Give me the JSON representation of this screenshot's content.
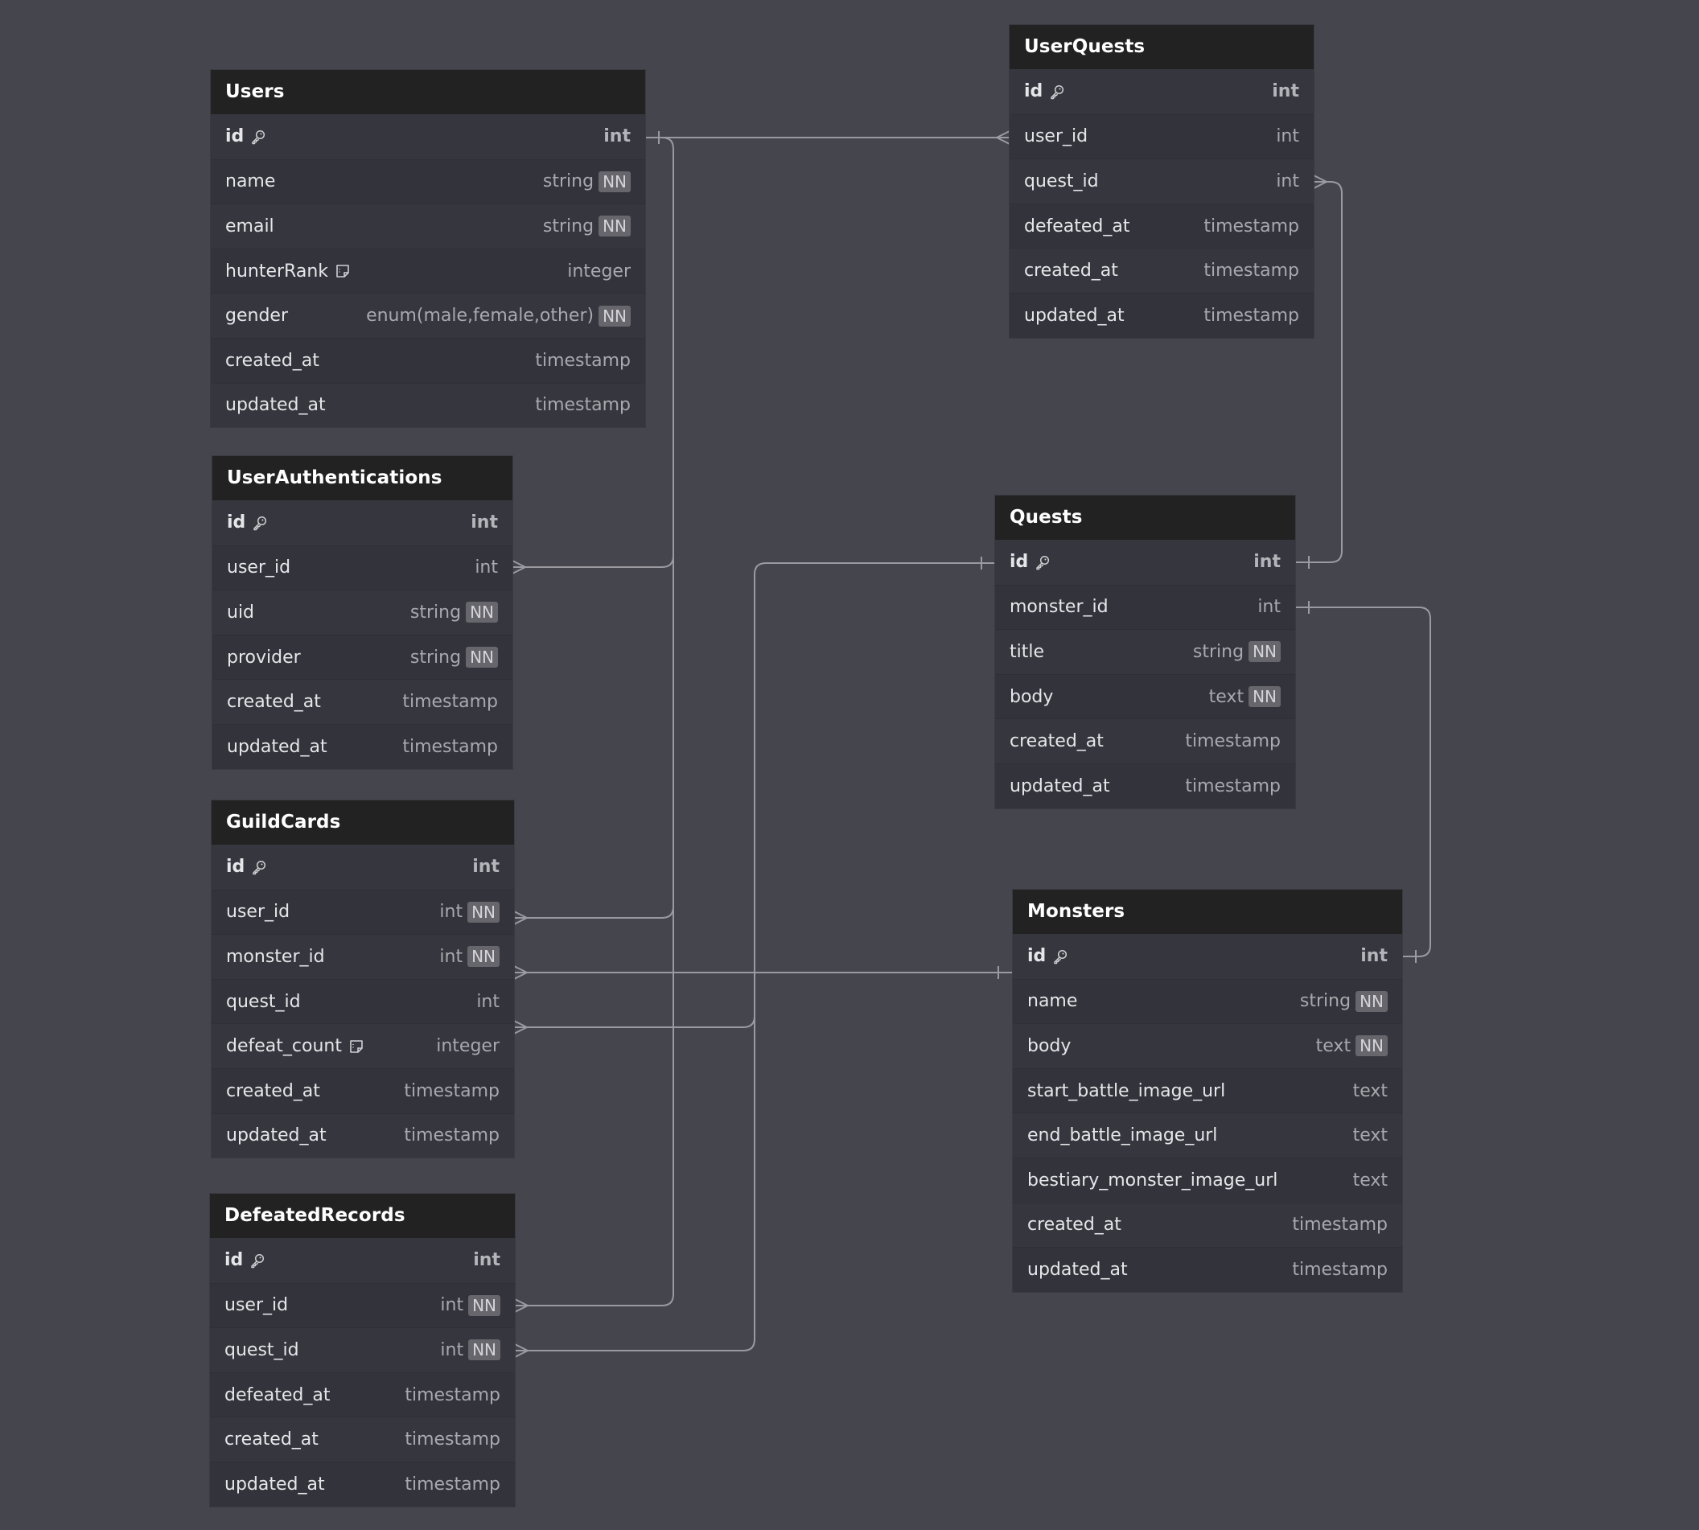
{
  "diagram": {
    "type": "entity-relationship",
    "tables": [
      {
        "id": "users",
        "name": "Users",
        "fields": [
          {
            "name": "id",
            "type": "int",
            "pk": true
          },
          {
            "name": "name",
            "type": "string",
            "nn": "NN"
          },
          {
            "name": "email",
            "type": "string",
            "nn": "NN"
          },
          {
            "name": "hunterRank",
            "type": "integer",
            "note": true
          },
          {
            "name": "gender",
            "type": "enum(male,female,other)",
            "nn": "NN"
          },
          {
            "name": "created_at",
            "type": "timestamp"
          },
          {
            "name": "updated_at",
            "type": "timestamp"
          }
        ]
      },
      {
        "id": "userauthentications",
        "name": "UserAuthentications",
        "fields": [
          {
            "name": "id",
            "type": "int",
            "pk": true
          },
          {
            "name": "user_id",
            "type": "int"
          },
          {
            "name": "uid",
            "type": "string",
            "nn": "NN"
          },
          {
            "name": "provider",
            "type": "string",
            "nn": "NN"
          },
          {
            "name": "created_at",
            "type": "timestamp"
          },
          {
            "name": "updated_at",
            "type": "timestamp"
          }
        ]
      },
      {
        "id": "guildcards",
        "name": "GuildCards",
        "fields": [
          {
            "name": "id",
            "type": "int",
            "pk": true
          },
          {
            "name": "user_id",
            "type": "int",
            "nn": "NN"
          },
          {
            "name": "monster_id",
            "type": "int",
            "nn": "NN"
          },
          {
            "name": "quest_id",
            "type": "int"
          },
          {
            "name": "defeat_count",
            "type": "integer",
            "note": true
          },
          {
            "name": "created_at",
            "type": "timestamp"
          },
          {
            "name": "updated_at",
            "type": "timestamp"
          }
        ]
      },
      {
        "id": "defeatedrecords",
        "name": "DefeatedRecords",
        "fields": [
          {
            "name": "id",
            "type": "int",
            "pk": true
          },
          {
            "name": "user_id",
            "type": "int",
            "nn": "NN"
          },
          {
            "name": "quest_id",
            "type": "int",
            "nn": "NN"
          },
          {
            "name": "defeated_at",
            "type": "timestamp"
          },
          {
            "name": "created_at",
            "type": "timestamp"
          },
          {
            "name": "updated_at",
            "type": "timestamp"
          }
        ]
      },
      {
        "id": "userquests",
        "name": "UserQuests",
        "fields": [
          {
            "name": "id",
            "type": "int",
            "pk": true
          },
          {
            "name": "user_id",
            "type": "int"
          },
          {
            "name": "quest_id",
            "type": "int"
          },
          {
            "name": "defeated_at",
            "type": "timestamp"
          },
          {
            "name": "created_at",
            "type": "timestamp"
          },
          {
            "name": "updated_at",
            "type": "timestamp"
          }
        ]
      },
      {
        "id": "quests",
        "name": "Quests",
        "fields": [
          {
            "name": "id",
            "type": "int",
            "pk": true
          },
          {
            "name": "monster_id",
            "type": "int"
          },
          {
            "name": "title",
            "type": "string",
            "nn": "NN"
          },
          {
            "name": "body",
            "type": "text",
            "nn": "NN"
          },
          {
            "name": "created_at",
            "type": "timestamp"
          },
          {
            "name": "updated_at",
            "type": "timestamp"
          }
        ]
      },
      {
        "id": "monsters",
        "name": "Monsters",
        "fields": [
          {
            "name": "id",
            "type": "int",
            "pk": true
          },
          {
            "name": "name",
            "type": "string",
            "nn": "NN"
          },
          {
            "name": "body",
            "type": "text",
            "nn": "NN"
          },
          {
            "name": "start_battle_image_url",
            "type": "text"
          },
          {
            "name": "end_battle_image_url",
            "type": "text"
          },
          {
            "name": "bestiary_monster_image_url",
            "type": "text"
          },
          {
            "name": "created_at",
            "type": "timestamp"
          },
          {
            "name": "updated_at",
            "type": "timestamp"
          }
        ]
      }
    ],
    "relationships": [
      {
        "from": "Users.id",
        "to": "UserQuests.user_id",
        "cardinality": "one-to-many"
      },
      {
        "from": "Users.id",
        "to": "UserAuthentications.user_id",
        "cardinality": "one-to-many"
      },
      {
        "from": "Users.id",
        "to": "GuildCards.user_id",
        "cardinality": "one-to-many"
      },
      {
        "from": "Users.id",
        "to": "DefeatedRecords.user_id",
        "cardinality": "one-to-many"
      },
      {
        "from": "Quests.id",
        "to": "UserQuests.quest_id",
        "cardinality": "one-to-many"
      },
      {
        "from": "Quests.id",
        "to": "GuildCards.quest_id",
        "cardinality": "one-to-many"
      },
      {
        "from": "Quests.id",
        "to": "DefeatedRecords.quest_id",
        "cardinality": "one-to-many"
      },
      {
        "from": "Monsters.id",
        "to": "GuildCards.monster_id",
        "cardinality": "one-to-many"
      },
      {
        "from": "Monsters.id",
        "to": "Quests.monster_id",
        "cardinality": "one-to-one"
      }
    ]
  },
  "colors": {
    "canvas": "#45454e",
    "header": "#222222",
    "row": "#35353d",
    "edge": "#9a9aa0",
    "nn_badge": "#66666c"
  }
}
